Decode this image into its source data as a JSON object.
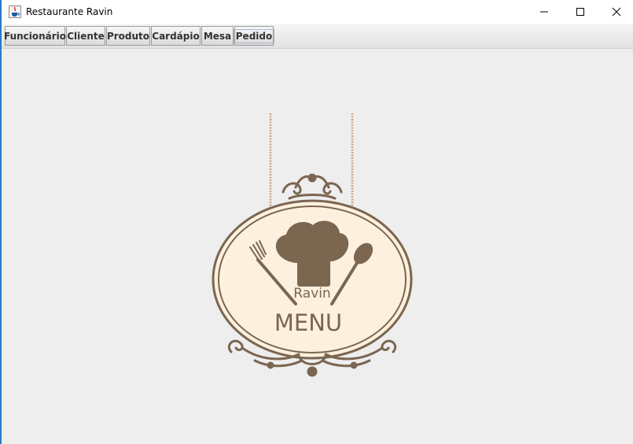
{
  "window": {
    "title": "Restaurante Ravin",
    "icon": "java-app-icon",
    "controls": [
      "minimize-icon",
      "maximize-icon",
      "close-icon"
    ]
  },
  "toolbar": {
    "buttons": [
      {
        "label": "Funcionário"
      },
      {
        "label": "Cliente"
      },
      {
        "label": "Produto"
      },
      {
        "label": "Cardápio"
      },
      {
        "label": "Mesa"
      },
      {
        "label": "Pedido",
        "focused": true
      }
    ]
  },
  "logo": {
    "top_text": "Ravin",
    "main_text": "MENU",
    "colors": {
      "brown": "#7b6650",
      "cream": "#fdf0de",
      "rope": "#c9a77a"
    }
  }
}
